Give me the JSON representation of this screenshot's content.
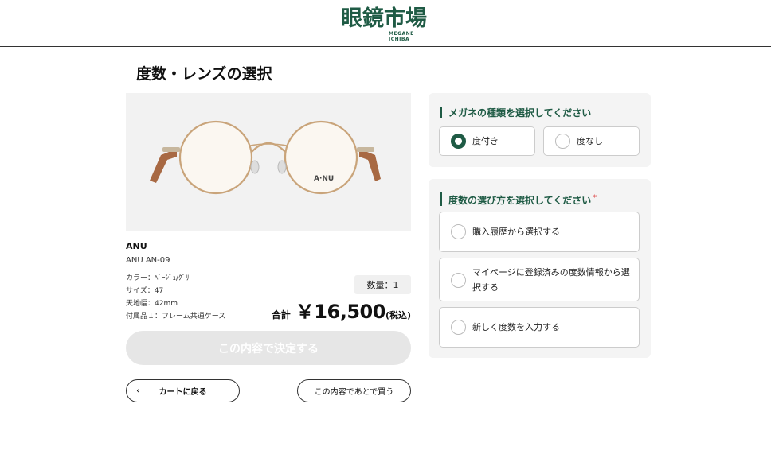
{
  "header": {
    "logo_text": "眼鏡市場",
    "logo_subtext": "MEGANE ICHIBA"
  },
  "page_title": "度数・レンズの選択",
  "product": {
    "brand": "ANU",
    "model": "ANU AN-09",
    "specs": [
      "カラー：ﾍﾞｰｼﾞｭ/ｸﾞﾘ",
      "サイズ：47",
      "天地幅：42mm",
      "付属品１：フレーム共通ケース"
    ],
    "quantity_label": "数量：1",
    "total_label": "合計",
    "price": "￥16,500",
    "tax_label": "(税込)"
  },
  "buttons": {
    "confirm": "この内容で決定する",
    "back_to_cart": "カートに戻る",
    "back_chevron": "‹",
    "buy_later": "この内容であとで買う"
  },
  "glasses_type": {
    "title": "メガネの種類を選択してください",
    "options": [
      {
        "label": "度付き",
        "checked": true
      },
      {
        "label": "度なし",
        "checked": false
      }
    ]
  },
  "prescription_method": {
    "title": "度数の選び方を選択してください",
    "required_mark": "*",
    "options": [
      {
        "label": "購入履歴から選択する",
        "checked": false
      },
      {
        "label": "マイページに登録済みの度数情報から選択する",
        "checked": false
      },
      {
        "label": "新しく度数を入力する",
        "checked": false
      }
    ]
  },
  "colors": {
    "brand_green": "#1f5b45",
    "frame_gold": "#c9a47a",
    "temple_brown": "#9a5a32",
    "disabled_button": "#e6e6e6",
    "required_red": "#e05a5a"
  }
}
